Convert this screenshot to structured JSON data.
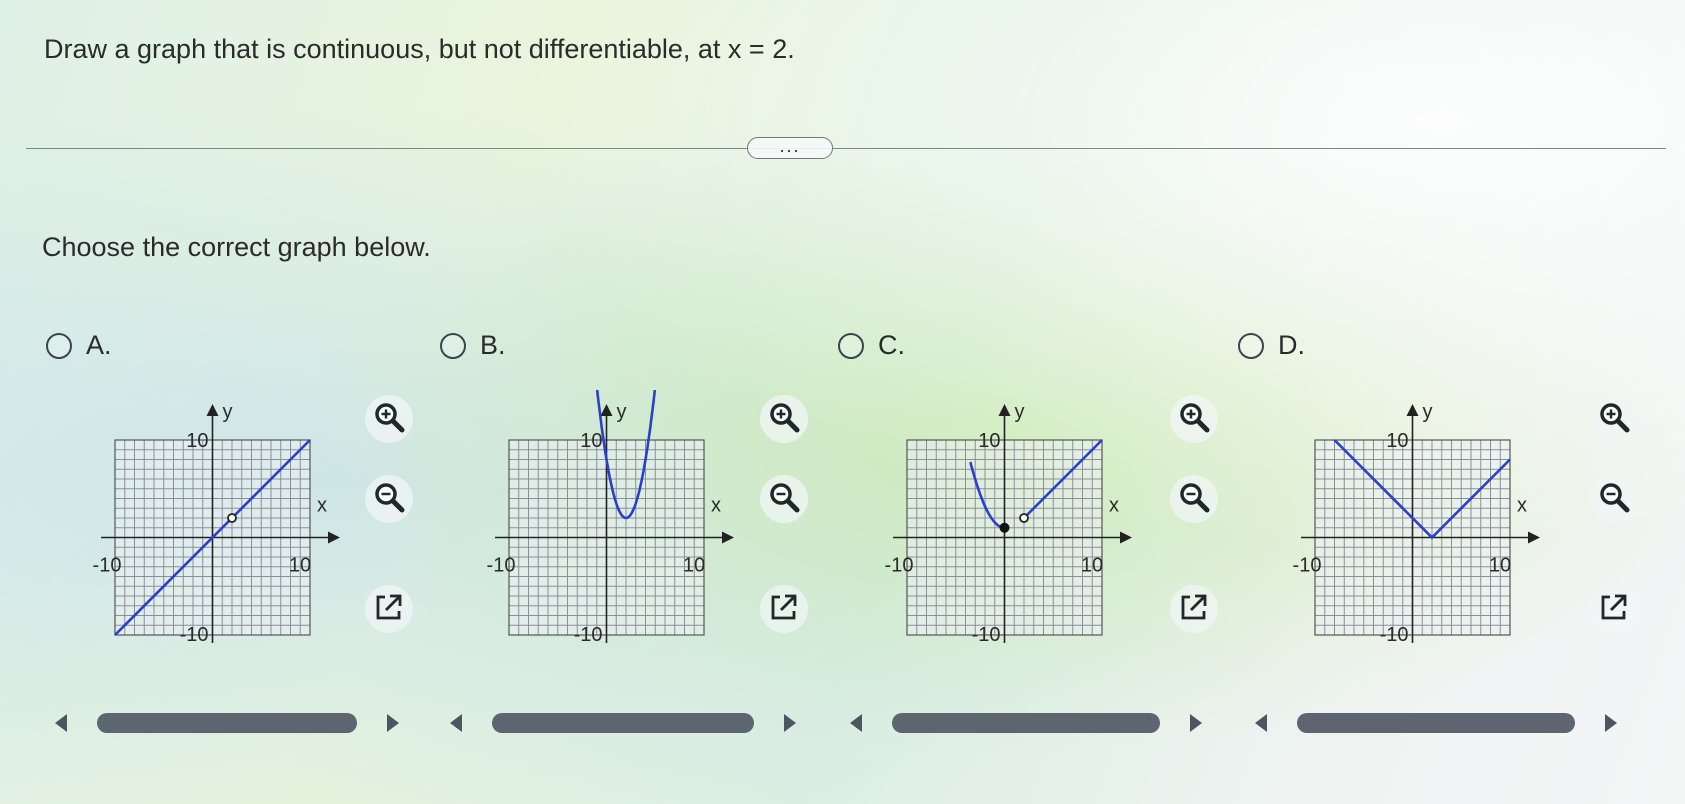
{
  "question": "Draw a graph that is continuous, but not differentiable, at x = 2.",
  "more_label": "...",
  "prompt": "Choose the correct graph below.",
  "options": [
    {
      "letter": "A.",
      "graph": "line-with-hole"
    },
    {
      "letter": "B.",
      "graph": "parabola"
    },
    {
      "letter": "C.",
      "graph": "jump-discontinuity"
    },
    {
      "letter": "D.",
      "graph": "absolute-value-corner"
    }
  ],
  "axis": {
    "x_label": "x",
    "y_label": "y",
    "ticks": {
      "x_min": "-10",
      "x_max": "10",
      "y_max": "10",
      "y_min": "-10"
    }
  },
  "colors": {
    "curve": "#2a3fd0",
    "grid": "#8a8f99",
    "text": "#2b2b2b"
  },
  "icons": {
    "zoom_in": "zoom-in-icon",
    "zoom_out": "zoom-out-icon",
    "popout": "popout-icon"
  }
}
